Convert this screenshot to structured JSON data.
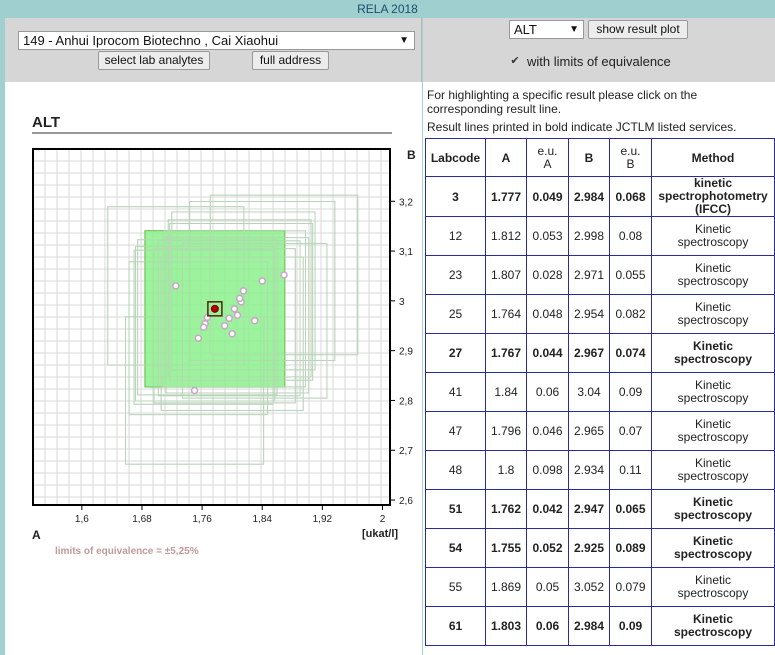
{
  "window_title": "RELA 2018",
  "lab_select": {
    "value": "149 - Anhui Iprocom Biotechno , Cai Xiaohui"
  },
  "buttons": {
    "select_lab_analytes": "select lab analytes",
    "full_address": "full address",
    "show_result_plot": "show result plot"
  },
  "analyte_select": {
    "value": "ALT"
  },
  "checkbox": {
    "label": "with limits of equivalence",
    "checked": true
  },
  "chart": {
    "title": "ALT",
    "corner_a": "A",
    "corner_b": "B",
    "unit": "[ukat/l]",
    "loe_note": "limits of equivalence = ±5,25%"
  },
  "chart_data": {
    "type": "scatter",
    "title": "ALT",
    "xlabel": "A",
    "ylabel": "B",
    "unit": "[ukat/l]",
    "xlim": [
      1.535,
      2.01
    ],
    "ylim": [
      2.59,
      3.305
    ],
    "x_ticks": [
      "1,6",
      "1,68",
      "1,76",
      "1,84",
      "1,92",
      "2"
    ],
    "x_tick_values": [
      1.6,
      1.68,
      1.76,
      1.84,
      1.92,
      2.0
    ],
    "y_ticks": [
      "2,6",
      "2,7",
      "2,8",
      "2,9",
      "3",
      "3,1",
      "3,2"
    ],
    "y_tick_values": [
      2.6,
      2.7,
      2.8,
      2.9,
      3.0,
      3.1,
      3.2
    ],
    "grid": true,
    "highlighted_point": {
      "x": 1.777,
      "y": 2.984
    },
    "equivalence_box": {
      "x": [
        1.684,
        1.87
      ],
      "y": [
        2.827,
        3.141
      ]
    },
    "points": [
      {
        "x": 1.777,
        "y": 2.984
      },
      {
        "x": 1.812,
        "y": 2.998
      },
      {
        "x": 1.807,
        "y": 2.971
      },
      {
        "x": 1.764,
        "y": 2.954
      },
      {
        "x": 1.767,
        "y": 2.967
      },
      {
        "x": 1.84,
        "y": 3.04
      },
      {
        "x": 1.796,
        "y": 2.965
      },
      {
        "x": 1.8,
        "y": 2.934
      },
      {
        "x": 1.762,
        "y": 2.947
      },
      {
        "x": 1.755,
        "y": 2.925
      },
      {
        "x": 1.869,
        "y": 3.052
      },
      {
        "x": 1.803,
        "y": 2.984
      },
      {
        "x": 1.725,
        "y": 3.03
      },
      {
        "x": 1.75,
        "y": 2.82
      },
      {
        "x": 1.83,
        "y": 2.96
      },
      {
        "x": 1.815,
        "y": 3.02
      },
      {
        "x": 1.79,
        "y": 2.95
      },
      {
        "x": 1.81,
        "y": 3.005
      }
    ]
  },
  "info": {
    "line1": "For highlighting a specific result please click on the",
    "line2": "corresponding result line.",
    "line3": "Result lines printed in bold indicate JCTLM listed services."
  },
  "table": {
    "headers": [
      "Labcode",
      "A",
      "e.u.",
      "B",
      "e.u.",
      "Method"
    ],
    "header_sub": [
      "",
      "",
      "A",
      "",
      "B",
      ""
    ],
    "rows": [
      {
        "code": "3",
        "a": "1.777",
        "eua": "0.049",
        "b": "2.984",
        "eub": "0.068",
        "m1": "kinetic",
        "m2": "spectrophotometry",
        "m3": "(IFCC)",
        "bold": true
      },
      {
        "code": "12",
        "a": "1.812",
        "eua": "0.053",
        "b": "2.998",
        "eub": "0.08",
        "m1": "Kinetic",
        "m2": "spectroscopy",
        "m3": "",
        "bold": false
      },
      {
        "code": "23",
        "a": "1.807",
        "eua": "0.028",
        "b": "2.971",
        "eub": "0.055",
        "m1": "Kinetic",
        "m2": "spectroscopy",
        "m3": "",
        "bold": false
      },
      {
        "code": "25",
        "a": "1.764",
        "eua": "0.048",
        "b": "2.954",
        "eub": "0.082",
        "m1": "Kinetic",
        "m2": "spectroscopy",
        "m3": "",
        "bold": false
      },
      {
        "code": "27",
        "a": "1.767",
        "eua": "0.044",
        "b": "2.967",
        "eub": "0.074",
        "m1": "Kinetic",
        "m2": "spectroscopy",
        "m3": "",
        "bold": true
      },
      {
        "code": "41",
        "a": "1.84",
        "eua": "0.06",
        "b": "3.04",
        "eub": "0.09",
        "m1": "Kinetic",
        "m2": "spectroscopy",
        "m3": "",
        "bold": false
      },
      {
        "code": "47",
        "a": "1.796",
        "eua": "0.046",
        "b": "2.965",
        "eub": "0.07",
        "m1": "Kinetic",
        "m2": "spectroscopy",
        "m3": "",
        "bold": false
      },
      {
        "code": "48",
        "a": "1.8",
        "eua": "0.098",
        "b": "2.934",
        "eub": "0.11",
        "m1": "Kinetic",
        "m2": "spectroscopy",
        "m3": "",
        "bold": false
      },
      {
        "code": "51",
        "a": "1.762",
        "eua": "0.042",
        "b": "2.947",
        "eub": "0.065",
        "m1": "Kinetic",
        "m2": "spectroscopy",
        "m3": "",
        "bold": true
      },
      {
        "code": "54",
        "a": "1.755",
        "eua": "0.052",
        "b": "2.925",
        "eub": "0.089",
        "m1": "Kinetic",
        "m2": "spectroscopy",
        "m3": "",
        "bold": true
      },
      {
        "code": "55",
        "a": "1.869",
        "eua": "0.05",
        "b": "3.052",
        "eub": "0.079",
        "m1": "Kinetic",
        "m2": "spectroscopy",
        "m3": "",
        "bold": false
      },
      {
        "code": "61",
        "a": "1.803",
        "eua": "0.06",
        "b": "2.984",
        "eub": "0.09",
        "m1": "Kinetic",
        "m2": "spectroscopy",
        "m3": "",
        "bold": true
      }
    ]
  }
}
